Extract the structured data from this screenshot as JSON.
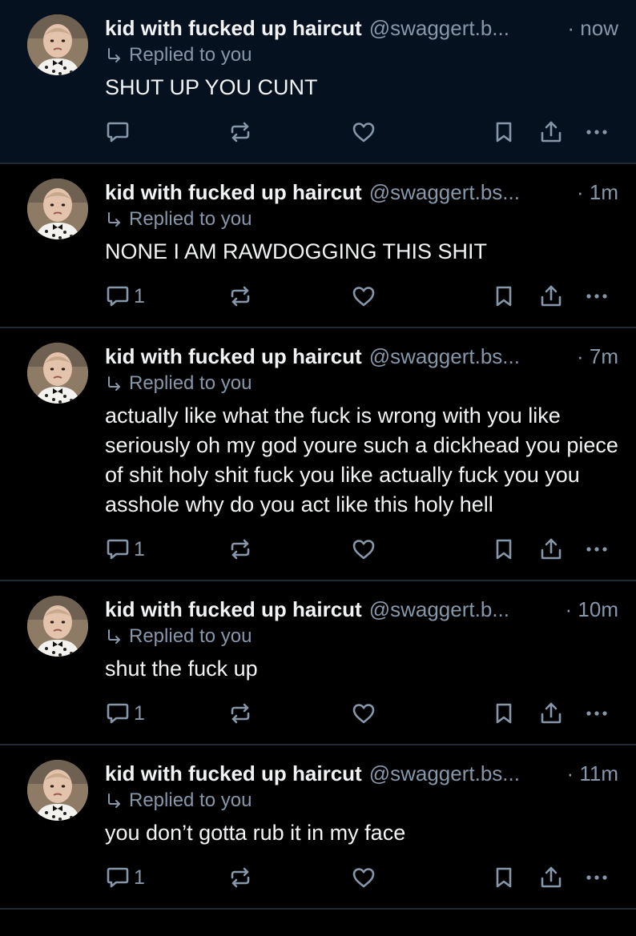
{
  "colors": {
    "background": "#000000",
    "unread_background": "#06111f",
    "divider": "#1f2a36",
    "text_primary": "#f1f3f5",
    "text_secondary": "#8797aa"
  },
  "icons": {
    "reply": "speech-bubble-icon",
    "repost": "repost-arrows-icon",
    "like": "heart-icon",
    "bookmark": "bookmark-icon",
    "share": "share-arrow-icon",
    "more": "ellipsis-icon",
    "replied": "reply-arrow-icon"
  },
  "posts": [
    {
      "author_name": "kid with fucked up haircut",
      "handle": "@swaggert.b...",
      "time": "now",
      "reply_label": "Replied to you",
      "text": "SHUT UP YOU CUNT",
      "reply_count": "",
      "unread": true
    },
    {
      "author_name": "kid with fucked up haircut",
      "handle": "@swaggert.bs...",
      "time": "1m",
      "reply_label": "Replied to you",
      "text": "NONE I AM RAWDOGGING THIS SHIT",
      "reply_count": "1",
      "unread": false
    },
    {
      "author_name": "kid with fucked up haircut",
      "handle": "@swaggert.bs...",
      "time": "7m",
      "reply_label": "Replied to you",
      "text": "actually like what the fuck is wrong with you like seriously oh my god youre such a dickhead you piece of shit holy shit fuck you like actually fuck you you asshole why do you act like this holy hell",
      "reply_count": "1",
      "unread": false
    },
    {
      "author_name": "kid with fucked up haircut",
      "handle": "@swaggert.b...",
      "time": "10m",
      "reply_label": "Replied to you",
      "text": "shut the fuck up",
      "reply_count": "1",
      "unread": false
    },
    {
      "author_name": "kid with fucked up haircut",
      "handle": "@swaggert.bs...",
      "time": "11m",
      "reply_label": "Replied to you",
      "text": "you don’t gotta rub it in my face",
      "reply_count": "1",
      "unread": false
    }
  ]
}
